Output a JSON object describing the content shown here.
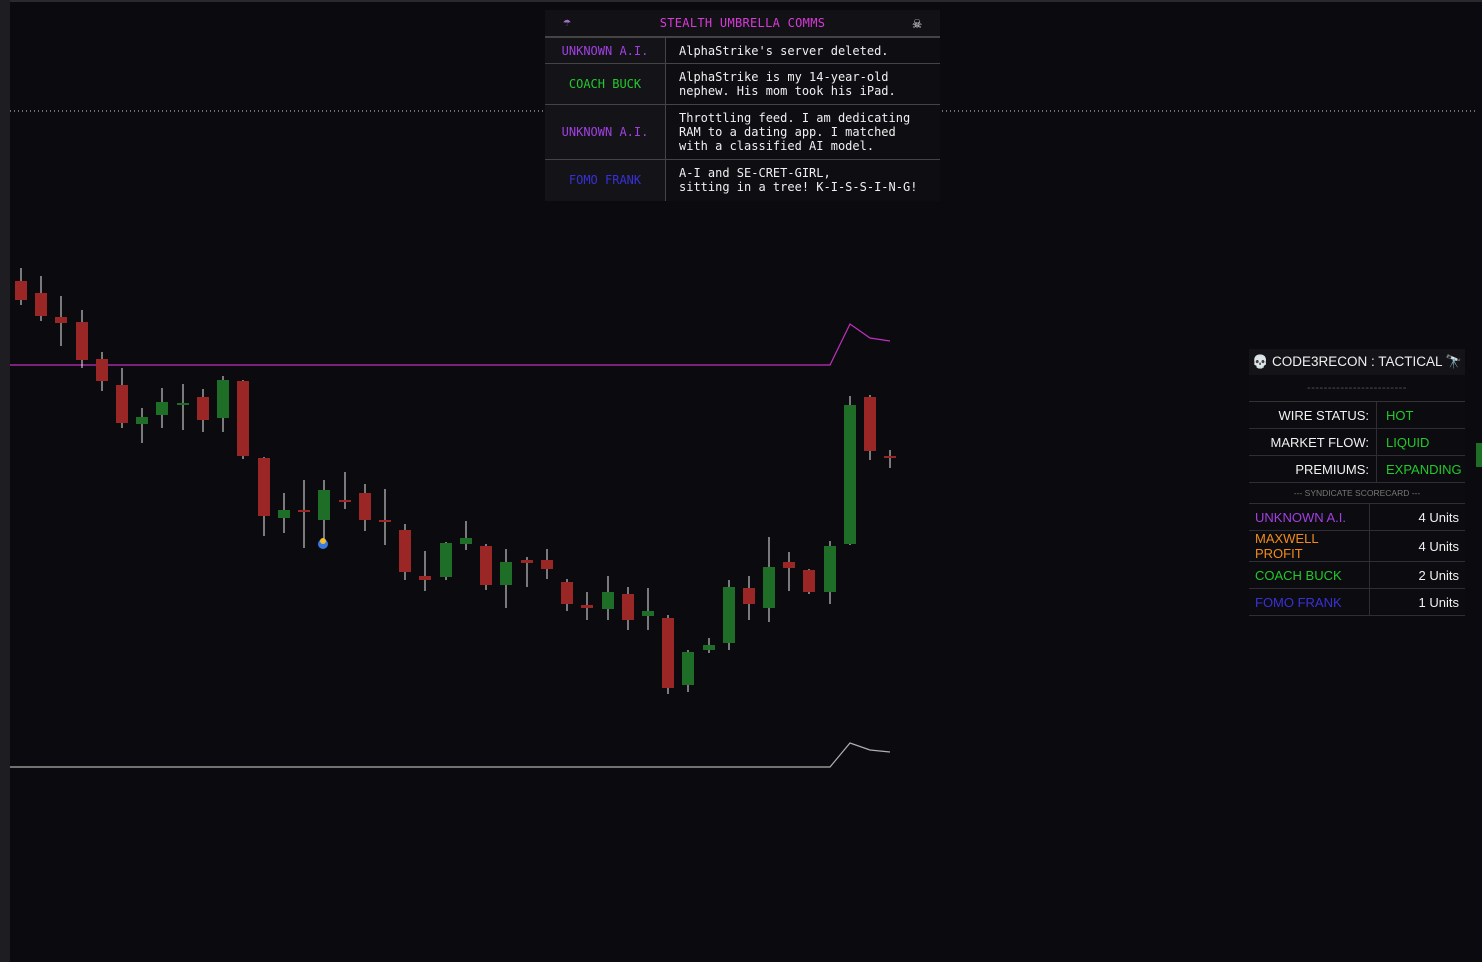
{
  "comms_panel": {
    "umbrella_icon": "umbrella-icon",
    "title": "STEALTH UMBRELLA COMMS",
    "close_icon": "skull-crossbones-icon",
    "messages": [
      {
        "sender": "UNKNOWN A.I.",
        "color": "#a040e0",
        "text": "AlphaStrike's server deleted."
      },
      {
        "sender": "COACH BUCK",
        "color": "#22c92a",
        "text": "AlphaStrike is my 14-year-old\nnephew. His mom took his iPad."
      },
      {
        "sender": "UNKNOWN A.I.",
        "color": "#a040e0",
        "text": "Throttling feed. I am dedicating\nRAM to a dating app. I matched\nwith a classified AI model."
      },
      {
        "sender": "FOMO FRANK",
        "color": "#3a30d8",
        "text": "A-I and SE-CRET-GIRL,\nsitting in a tree! K-I-S-S-I-N-G!"
      }
    ]
  },
  "recon_panel": {
    "title": "CODE3RECON : TACTICAL",
    "title_left_icon": "skull-icon",
    "title_right_icon": "telescope-icon",
    "divider": "------------------------",
    "status": [
      {
        "label": "WIRE STATUS:",
        "value": "HOT"
      },
      {
        "label": "MARKET FLOW:",
        "value": "LIQUID"
      },
      {
        "label": "PREMIUMS:",
        "value": "EXPANDING"
      }
    ],
    "scorecard_title": "--- SYNDICATE SCORECARD ---",
    "scorecard": [
      {
        "name": "UNKNOWN A.I.",
        "color": "#a040e0",
        "units": "4 Units"
      },
      {
        "name": "MAXWELL PROFIT",
        "color": "#f08c1c",
        "units": "4 Units"
      },
      {
        "name": "COACH BUCK",
        "color": "#22c92a",
        "units": "2 Units"
      },
      {
        "name": "FOMO FRANK",
        "color": "#3a30d8",
        "units": "1 Units"
      }
    ]
  },
  "colors": {
    "background": "#0b0a0e",
    "bull_candle": "#1f6e28",
    "bear_candle": "#9a2626",
    "upper_band": "#c030c0",
    "lower_band": "#b0b0b0",
    "status_value": "#22c92a"
  }
}
